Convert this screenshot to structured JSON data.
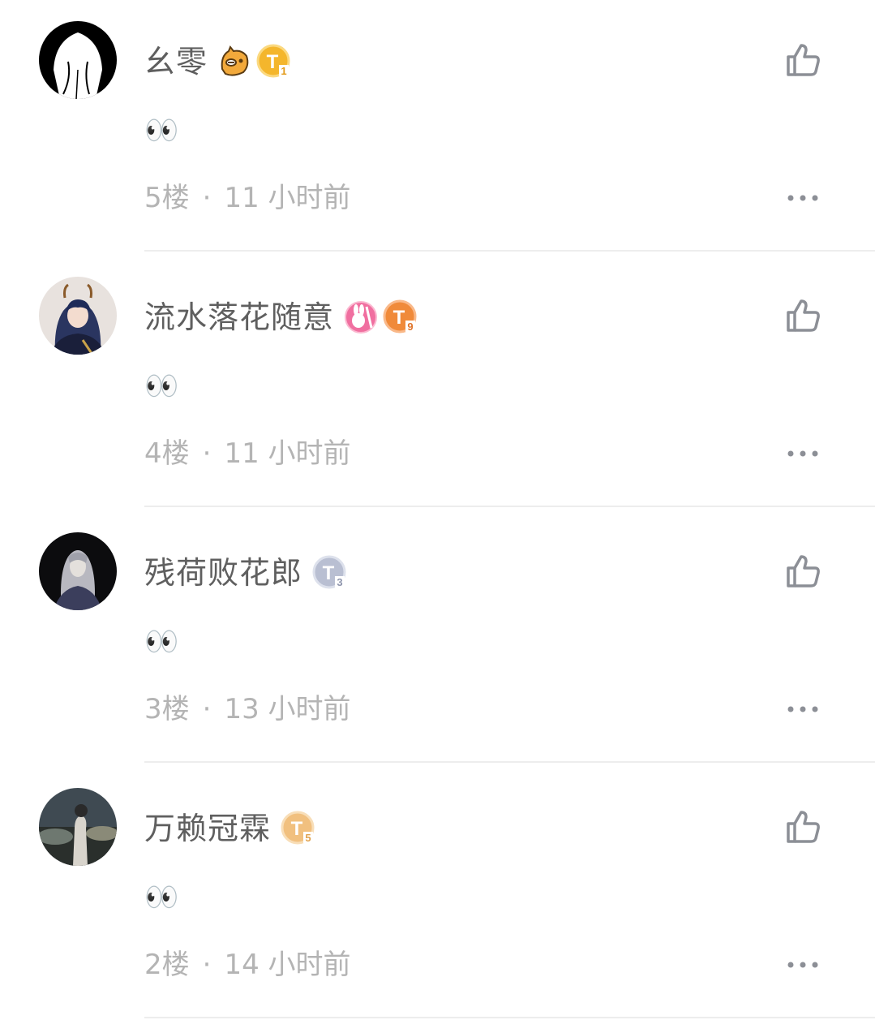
{
  "comments": [
    {
      "username": "幺零",
      "content": "👀",
      "floor": "5楼",
      "separator": "·",
      "time": "11 小时前",
      "badges": [
        {
          "icon": "cat-face-badge-icon",
          "color": "#f2a93b"
        },
        {
          "icon": "t-level-badge-icon",
          "label": "T",
          "level": "1",
          "color": "#f4b62c"
        }
      ]
    },
    {
      "username": "流水落花随意",
      "content": "👀",
      "floor": "4楼",
      "separator": "·",
      "time": "11 小时前",
      "badges": [
        {
          "icon": "rabbit-2023-badge-icon",
          "color": "#f06fa0"
        },
        {
          "icon": "t-level-badge-icon",
          "label": "T",
          "level": "9",
          "color": "#f08a3a"
        }
      ]
    },
    {
      "username": "残荷败花郎",
      "content": "👀",
      "floor": "3楼",
      "separator": "·",
      "time": "13 小时前",
      "badges": [
        {
          "icon": "t-level-badge-icon",
          "label": "T",
          "level": "3",
          "color": "#b9bfd2"
        }
      ]
    },
    {
      "username": "万赖冠霖",
      "content": "👀",
      "floor": "2楼",
      "separator": "·",
      "time": "14 小时前",
      "badges": [
        {
          "icon": "t-level-badge-icon",
          "label": "T",
          "level": "5",
          "color": "#f1c07f"
        }
      ]
    }
  ],
  "icons": {
    "like": "thumbs-up-icon",
    "more": "more-dots-icon"
  },
  "colors": {
    "username": "#5f5f5f",
    "meta": "#b4b4b4",
    "icon": "#8c8f96",
    "divider": "#ededed"
  }
}
